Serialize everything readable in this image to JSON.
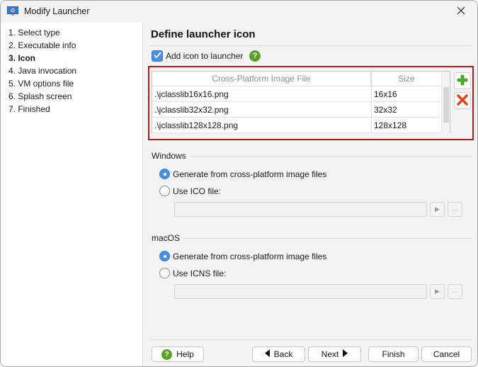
{
  "window": {
    "title": "Modify Launcher",
    "app_icon": "monitor-icon",
    "close_icon": "close-icon"
  },
  "sidebar": {
    "steps": [
      {
        "label": "1. Select type",
        "active": false
      },
      {
        "label": "2. Executable info",
        "active": false
      },
      {
        "label": "3. Icon",
        "active": true
      },
      {
        "label": "4. Java invocation",
        "active": false
      },
      {
        "label": "5. VM options file",
        "active": false
      },
      {
        "label": "6. Splash screen",
        "active": false
      },
      {
        "label": "7. Finished",
        "active": false
      }
    ]
  },
  "main": {
    "title": "Define launcher icon",
    "add_icon_checkbox": {
      "label": "Add icon to launcher",
      "checked": true
    },
    "help_icon": "help-icon",
    "image_table": {
      "columns": [
        "Cross-Platform Image File",
        "Size"
      ],
      "rows": [
        {
          "file": ".\\jclasslib16x16.png",
          "size": "16x16"
        },
        {
          "file": ".\\jclasslib32x32.png",
          "size": "32x32"
        },
        {
          "file": ".\\jclasslib128x128.png",
          "size": "128x128"
        }
      ],
      "add_icon": "plus-icon",
      "remove_icon": "delete-x-icon"
    },
    "windows": {
      "label": "Windows",
      "options": [
        {
          "label": "Generate from cross-platform image files",
          "selected": true
        },
        {
          "label": "Use ICO file:",
          "selected": false
        }
      ],
      "file_value": ""
    },
    "macos": {
      "label": "macOS",
      "options": [
        {
          "label": "Generate from cross-platform image files",
          "selected": true
        },
        {
          "label": "Use ICNS file:",
          "selected": false
        }
      ],
      "file_value": ""
    }
  },
  "footer": {
    "help": "Help",
    "back": "Back",
    "next": "Next",
    "finish": "Finish",
    "cancel": "Cancel"
  },
  "colors": {
    "accent": "#4a8fe0",
    "highlight_border": "#b71c1c",
    "help_green": "#5aa02c",
    "add_green": "#4caf1f",
    "remove_red": "#e0461c"
  }
}
